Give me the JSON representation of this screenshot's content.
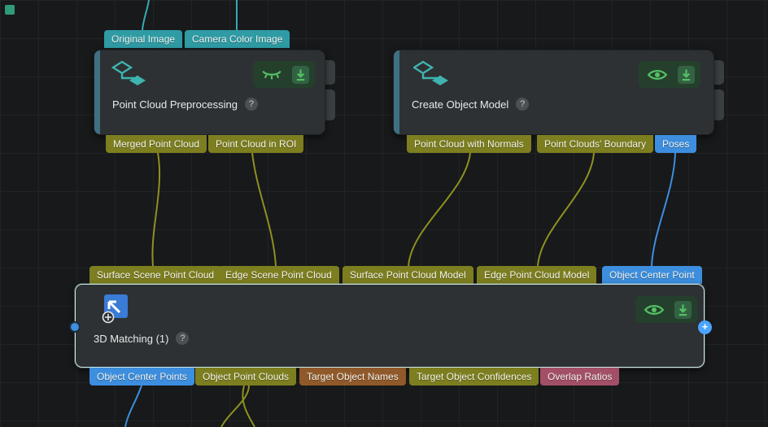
{
  "colors": {
    "tag_teal": "#2f9ba5",
    "tag_olive": "#7d7e1f",
    "tag_blue": "#3d8ede",
    "tag_brown": "#90592a",
    "tag_maroon": "#a34f68",
    "wire_teal": "#35aab4",
    "wire_olive": "#8f9021",
    "wire_blue": "#3d8ede",
    "icon_green": "#55c065",
    "node_bg": "#2d3134",
    "canvas_bg": "#17191a"
  },
  "top_inputs": {
    "original_image": "Original Image",
    "camera_color_image": "Camera Color Image"
  },
  "nodes": {
    "preprocessing": {
      "title": "Point Cloud Preprocessing",
      "help": "?",
      "outputs": {
        "merged": "Merged Point Cloud",
        "roi": "Point Cloud in ROI"
      }
    },
    "create_model": {
      "title": "Create Object Model",
      "help": "?",
      "outputs": {
        "normals": "Point Cloud with Normals",
        "boundary": "Point Clouds' Boundary",
        "poses": "Poses"
      }
    },
    "matching": {
      "title": "3D Matching (1)",
      "help": "?",
      "add_port": "+",
      "inputs": {
        "surface_scene": "Surface Scene Point Cloud",
        "edge_scene": "Edge Scene Point Cloud",
        "surface_model": "Surface Point Cloud Model",
        "edge_model": "Edge Point Cloud Model",
        "center_point": "Object Center Point"
      },
      "outputs": {
        "center_points": "Object Center Points",
        "point_clouds": "Object Point Clouds",
        "names": "Target Object Names",
        "confidences": "Target Object Confidences",
        "overlap": "Overlap Ratios"
      }
    }
  },
  "icons": {
    "eye_off": "eye-off-icon",
    "eye_on": "eye-icon",
    "download": "download-arrow-icon",
    "help": "question-mark-icon",
    "add": "plus-icon"
  }
}
